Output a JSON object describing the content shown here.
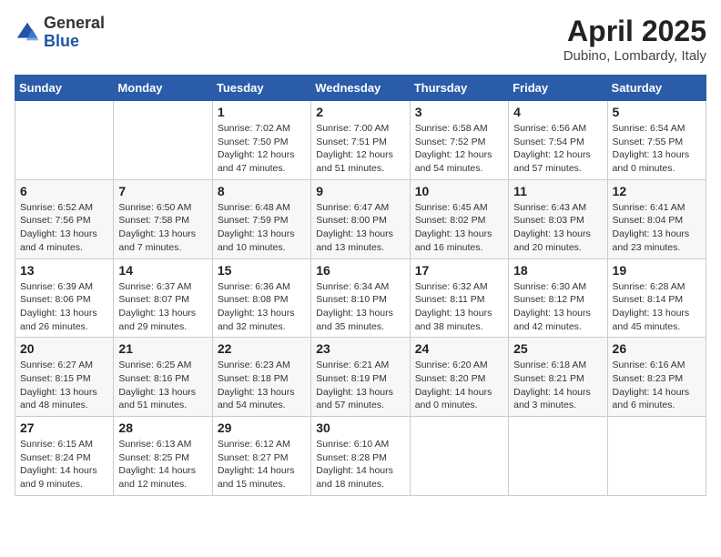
{
  "logo": {
    "general": "General",
    "blue": "Blue"
  },
  "title": "April 2025",
  "location": "Dubino, Lombardy, Italy",
  "days_of_week": [
    "Sunday",
    "Monday",
    "Tuesday",
    "Wednesday",
    "Thursday",
    "Friday",
    "Saturday"
  ],
  "weeks": [
    [
      {
        "day": "",
        "info": ""
      },
      {
        "day": "",
        "info": ""
      },
      {
        "day": "1",
        "info": "Sunrise: 7:02 AM\nSunset: 7:50 PM\nDaylight: 12 hours and 47 minutes."
      },
      {
        "day": "2",
        "info": "Sunrise: 7:00 AM\nSunset: 7:51 PM\nDaylight: 12 hours and 51 minutes."
      },
      {
        "day": "3",
        "info": "Sunrise: 6:58 AM\nSunset: 7:52 PM\nDaylight: 12 hours and 54 minutes."
      },
      {
        "day": "4",
        "info": "Sunrise: 6:56 AM\nSunset: 7:54 PM\nDaylight: 12 hours and 57 minutes."
      },
      {
        "day": "5",
        "info": "Sunrise: 6:54 AM\nSunset: 7:55 PM\nDaylight: 13 hours and 0 minutes."
      }
    ],
    [
      {
        "day": "6",
        "info": "Sunrise: 6:52 AM\nSunset: 7:56 PM\nDaylight: 13 hours and 4 minutes."
      },
      {
        "day": "7",
        "info": "Sunrise: 6:50 AM\nSunset: 7:58 PM\nDaylight: 13 hours and 7 minutes."
      },
      {
        "day": "8",
        "info": "Sunrise: 6:48 AM\nSunset: 7:59 PM\nDaylight: 13 hours and 10 minutes."
      },
      {
        "day": "9",
        "info": "Sunrise: 6:47 AM\nSunset: 8:00 PM\nDaylight: 13 hours and 13 minutes."
      },
      {
        "day": "10",
        "info": "Sunrise: 6:45 AM\nSunset: 8:02 PM\nDaylight: 13 hours and 16 minutes."
      },
      {
        "day": "11",
        "info": "Sunrise: 6:43 AM\nSunset: 8:03 PM\nDaylight: 13 hours and 20 minutes."
      },
      {
        "day": "12",
        "info": "Sunrise: 6:41 AM\nSunset: 8:04 PM\nDaylight: 13 hours and 23 minutes."
      }
    ],
    [
      {
        "day": "13",
        "info": "Sunrise: 6:39 AM\nSunset: 8:06 PM\nDaylight: 13 hours and 26 minutes."
      },
      {
        "day": "14",
        "info": "Sunrise: 6:37 AM\nSunset: 8:07 PM\nDaylight: 13 hours and 29 minutes."
      },
      {
        "day": "15",
        "info": "Sunrise: 6:36 AM\nSunset: 8:08 PM\nDaylight: 13 hours and 32 minutes."
      },
      {
        "day": "16",
        "info": "Sunrise: 6:34 AM\nSunset: 8:10 PM\nDaylight: 13 hours and 35 minutes."
      },
      {
        "day": "17",
        "info": "Sunrise: 6:32 AM\nSunset: 8:11 PM\nDaylight: 13 hours and 38 minutes."
      },
      {
        "day": "18",
        "info": "Sunrise: 6:30 AM\nSunset: 8:12 PM\nDaylight: 13 hours and 42 minutes."
      },
      {
        "day": "19",
        "info": "Sunrise: 6:28 AM\nSunset: 8:14 PM\nDaylight: 13 hours and 45 minutes."
      }
    ],
    [
      {
        "day": "20",
        "info": "Sunrise: 6:27 AM\nSunset: 8:15 PM\nDaylight: 13 hours and 48 minutes."
      },
      {
        "day": "21",
        "info": "Sunrise: 6:25 AM\nSunset: 8:16 PM\nDaylight: 13 hours and 51 minutes."
      },
      {
        "day": "22",
        "info": "Sunrise: 6:23 AM\nSunset: 8:18 PM\nDaylight: 13 hours and 54 minutes."
      },
      {
        "day": "23",
        "info": "Sunrise: 6:21 AM\nSunset: 8:19 PM\nDaylight: 13 hours and 57 minutes."
      },
      {
        "day": "24",
        "info": "Sunrise: 6:20 AM\nSunset: 8:20 PM\nDaylight: 14 hours and 0 minutes."
      },
      {
        "day": "25",
        "info": "Sunrise: 6:18 AM\nSunset: 8:21 PM\nDaylight: 14 hours and 3 minutes."
      },
      {
        "day": "26",
        "info": "Sunrise: 6:16 AM\nSunset: 8:23 PM\nDaylight: 14 hours and 6 minutes."
      }
    ],
    [
      {
        "day": "27",
        "info": "Sunrise: 6:15 AM\nSunset: 8:24 PM\nDaylight: 14 hours and 9 minutes."
      },
      {
        "day": "28",
        "info": "Sunrise: 6:13 AM\nSunset: 8:25 PM\nDaylight: 14 hours and 12 minutes."
      },
      {
        "day": "29",
        "info": "Sunrise: 6:12 AM\nSunset: 8:27 PM\nDaylight: 14 hours and 15 minutes."
      },
      {
        "day": "30",
        "info": "Sunrise: 6:10 AM\nSunset: 8:28 PM\nDaylight: 14 hours and 18 minutes."
      },
      {
        "day": "",
        "info": ""
      },
      {
        "day": "",
        "info": ""
      },
      {
        "day": "",
        "info": ""
      }
    ]
  ]
}
